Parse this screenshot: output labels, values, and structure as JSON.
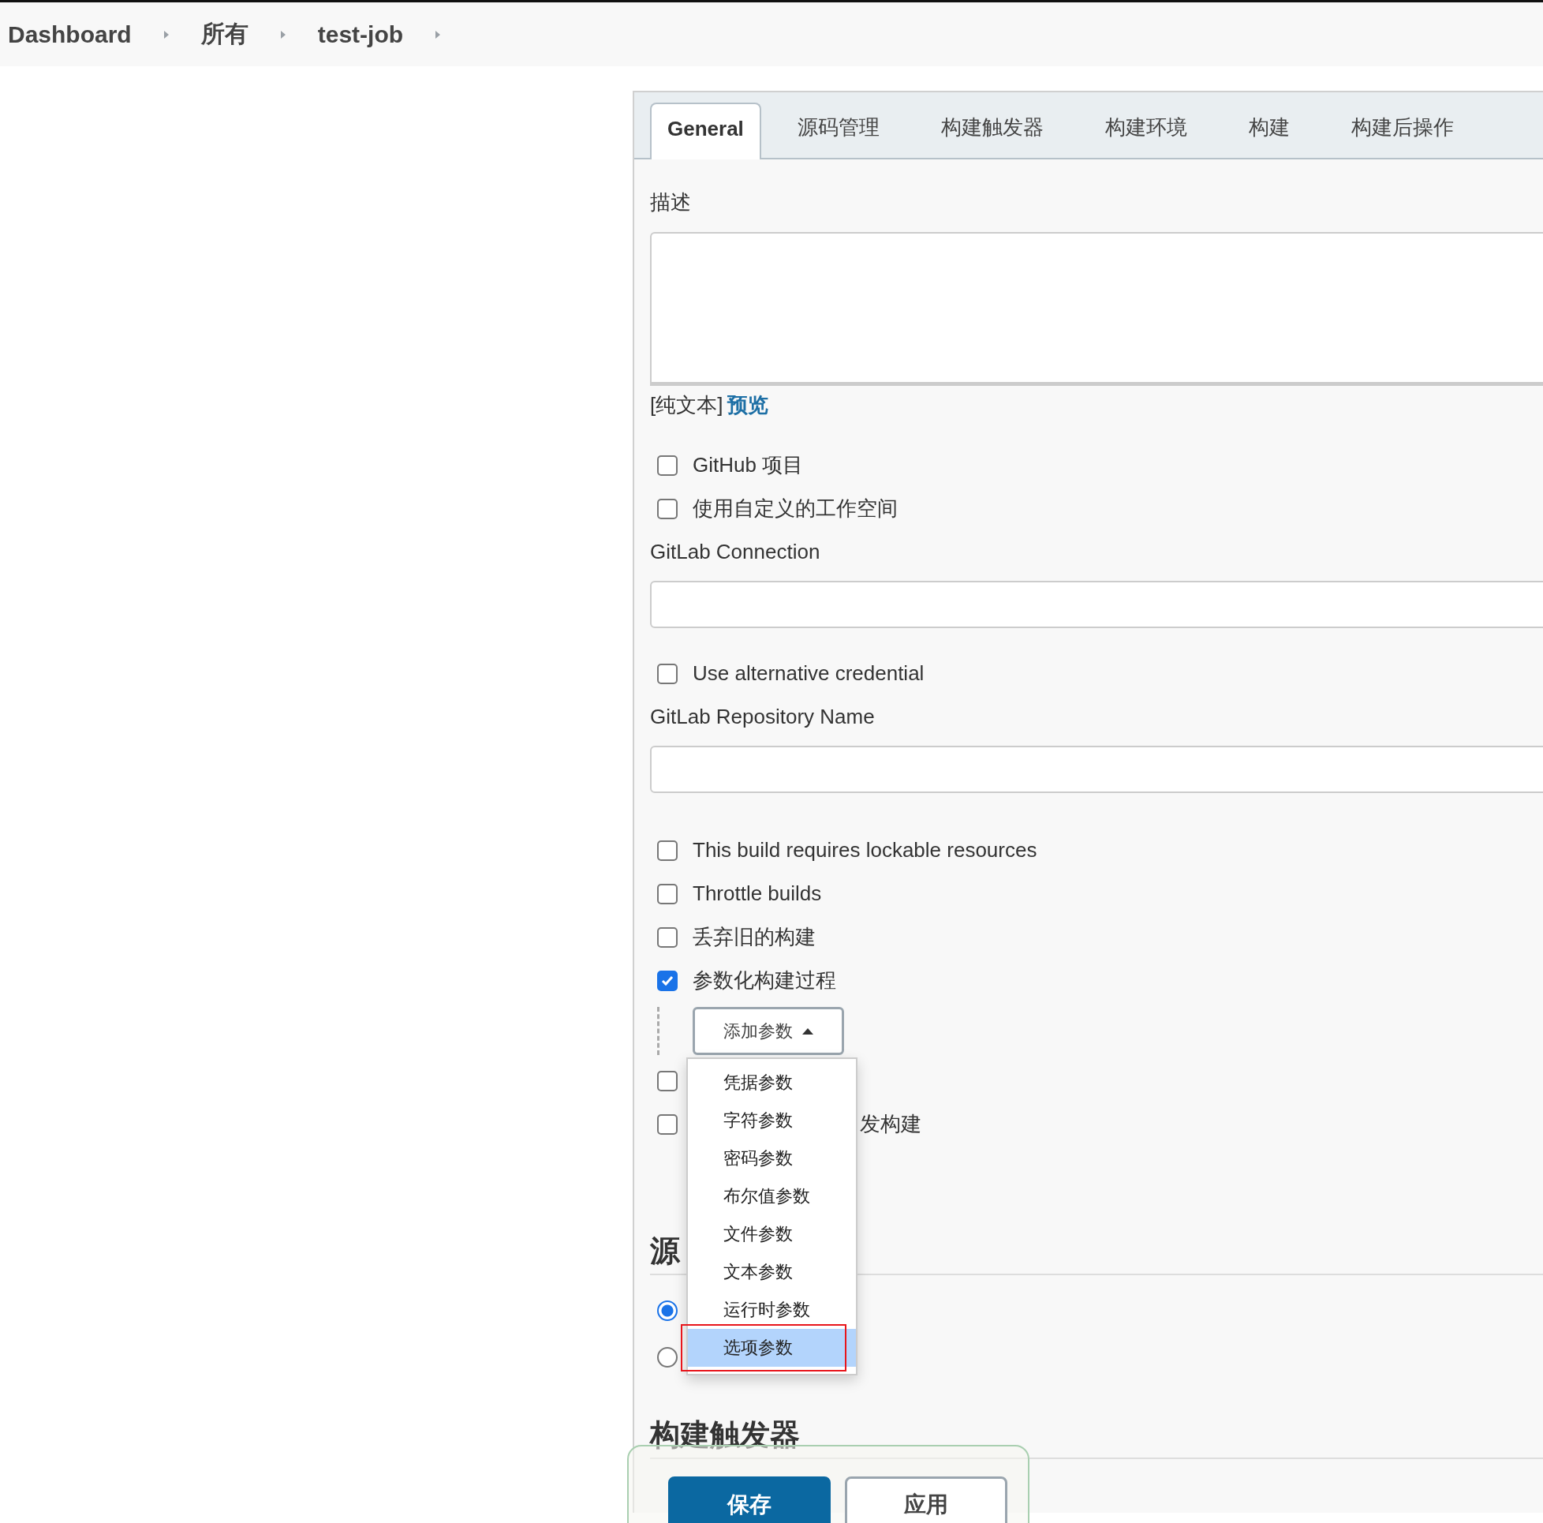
{
  "breadcrumb": [
    {
      "label": "Dashboard"
    },
    {
      "label": "所有"
    },
    {
      "label": "test-job"
    }
  ],
  "tabs": [
    {
      "label": "General",
      "selected": true
    },
    {
      "label": "源码管理",
      "selected": false
    },
    {
      "label": "构建触发器",
      "selected": false
    },
    {
      "label": "构建环境",
      "selected": false
    },
    {
      "label": "构建",
      "selected": false
    },
    {
      "label": "构建后操作",
      "selected": false
    }
  ],
  "description": {
    "label": "描述",
    "format_note": "[纯文本]",
    "preview_link": "预览"
  },
  "general_items": [
    {
      "kind": "checkbox",
      "label": "GitHub 项目",
      "checked": false
    },
    {
      "kind": "checkbox",
      "label": "使用自定义的工作空间",
      "checked": false
    },
    {
      "kind": "field",
      "label": "GitLab Connection"
    },
    {
      "kind": "checkbox",
      "label": "Use alternative credential",
      "checked": false
    },
    {
      "kind": "field",
      "label": "GitLab Repository Name"
    },
    {
      "kind": "checkbox",
      "label": "This build requires lockable resources",
      "checked": false
    },
    {
      "kind": "checkbox",
      "label": "Throttle builds",
      "checked": false
    },
    {
      "kind": "checkbox",
      "label": "丢弃旧的构建",
      "checked": false
    },
    {
      "kind": "checkbox",
      "label": "参数化构建过程",
      "checked": true
    }
  ],
  "add_parameter_button": {
    "label": "添加参数",
    "expanded": true
  },
  "parameter_menu": [
    {
      "label": "凭据参数",
      "selected": false
    },
    {
      "label": "字符参数",
      "selected": false
    },
    {
      "label": "密码参数",
      "selected": false
    },
    {
      "label": "布尔值参数",
      "selected": false
    },
    {
      "label": "文件参数",
      "selected": false
    },
    {
      "label": "文本参数",
      "selected": false
    },
    {
      "label": "运行时参数",
      "selected": false
    },
    {
      "label": "选项参数",
      "selected": true
    }
  ],
  "more_items": [
    {
      "checked": false
    },
    {
      "checked": false,
      "label": "发构建",
      "covered": true
    }
  ],
  "source_section": {
    "heading": "源",
    "radios": [
      {
        "selected": true
      },
      {
        "selected": false
      }
    ]
  },
  "trigger_section": {
    "heading": "构建触发器"
  },
  "footer_buttons": [
    {
      "label": "保存",
      "kind": "primary"
    },
    {
      "label": "应用",
      "kind": "secondary"
    }
  ]
}
